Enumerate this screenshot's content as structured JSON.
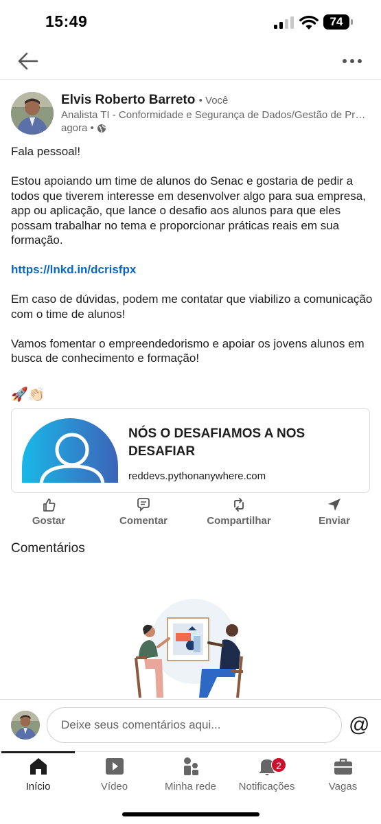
{
  "status_bar": {
    "time": "15:49",
    "battery": "74"
  },
  "post": {
    "author_name": "Elvis Roberto Barreto",
    "author_you": "• Você",
    "author_headline": "Analista TI - Conformidade e Segurança de Dados/Gestão de Projetos",
    "time": "agora •",
    "paragraphs": [
      "Fala pessoal!",
      "Estou apoiando um time de alunos do Senac e gostaria de pedir a todos que tiverem interesse em desenvolver algo para sua  empresa, app ou aplicação, que lance o desafio aos alunos para que eles possam trabalhar no tema e proporcionar práticas reais em sua formação."
    ],
    "link": "https://lnkd.in/dcrisfpx",
    "paragraphs_after": [
      "Em caso de dúvidas, podem me contatar que viabilizo a comunicação com o time de alunos!",
      "Vamos fomentar o empreendedorismo e apoiar os jovens alunos em busca de conhecimento e formação!"
    ],
    "emojis": "🚀👏🏻"
  },
  "link_card": {
    "title": "NÓS O DESAFIAMOS A NOS DESAFIAR",
    "domain": "reddevs.pythonanywhere.com"
  },
  "actions": {
    "like": "Gostar",
    "comment": "Comentar",
    "share": "Compartilhar",
    "send": "Enviar"
  },
  "comments_heading": "Comentários",
  "comment_bar": {
    "placeholder": "Deixe seus comentários aqui...",
    "mention_symbol": "@"
  },
  "nav": {
    "home": "Início",
    "video": "Vídeo",
    "network": "Minha rede",
    "notifications": "Notificações",
    "notifications_badge": "2",
    "jobs": "Vagas"
  },
  "colors": {
    "link": "#0a66c2",
    "badge": "#cb112d",
    "card_gradient_start": "#19b8e8",
    "card_gradient_end": "#3d63b8"
  }
}
